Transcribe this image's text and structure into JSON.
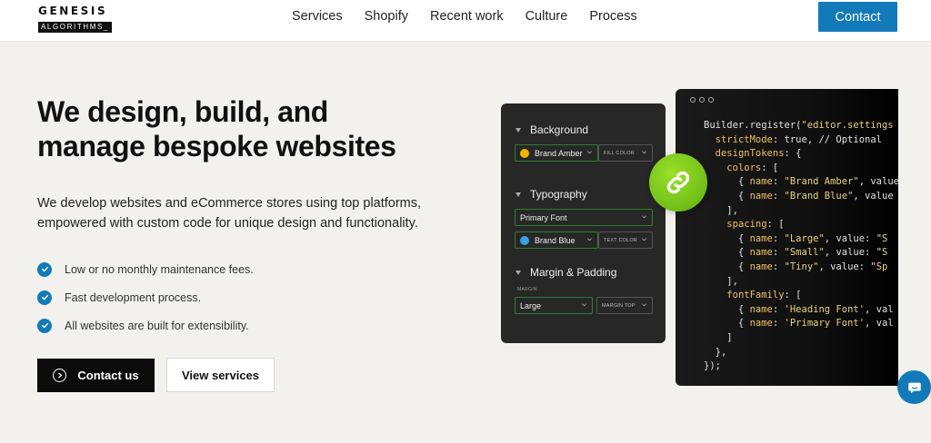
{
  "header": {
    "logo_top": "GENESIS",
    "logo_bottom": "ALGORITHMS_",
    "nav": [
      "Services",
      "Shopify",
      "Recent work",
      "Culture",
      "Process"
    ],
    "contact_label": "Contact"
  },
  "hero": {
    "title_line1": "We design, build, and",
    "title_line2": "manage bespoke websites",
    "subtitle_line1": "We develop websites and eCommerce stores using top platforms,",
    "subtitle_line2": "empowered with custom code for unique design and functionality.",
    "features": [
      "Low or no monthly maintenance fees.",
      "Fast development process.",
      "All websites are built for extensibility."
    ],
    "cta_primary": "Contact us",
    "cta_secondary": "View services"
  },
  "panel": {
    "background_title": "Background",
    "brand_amber": "Brand Amber",
    "fill_color": "FILL COLOR",
    "typography_title": "Typography",
    "primary_font": "Primary Font",
    "brand_blue": "Brand Blue",
    "text_color": "TEXT COLOR",
    "margin_title": "Margin & Padding",
    "margin_label": "MARGIN",
    "large": "Large",
    "margin_top": "MARGIN TOP"
  },
  "colors": {
    "accent": "#137ab9",
    "amber": "#f5b400",
    "blue": "#3aa0e0",
    "green": "#6cc21a"
  },
  "icons": {
    "check": "check-circle-icon",
    "play": "play-circle-icon",
    "link": "link-icon",
    "chat": "chat-icon"
  }
}
